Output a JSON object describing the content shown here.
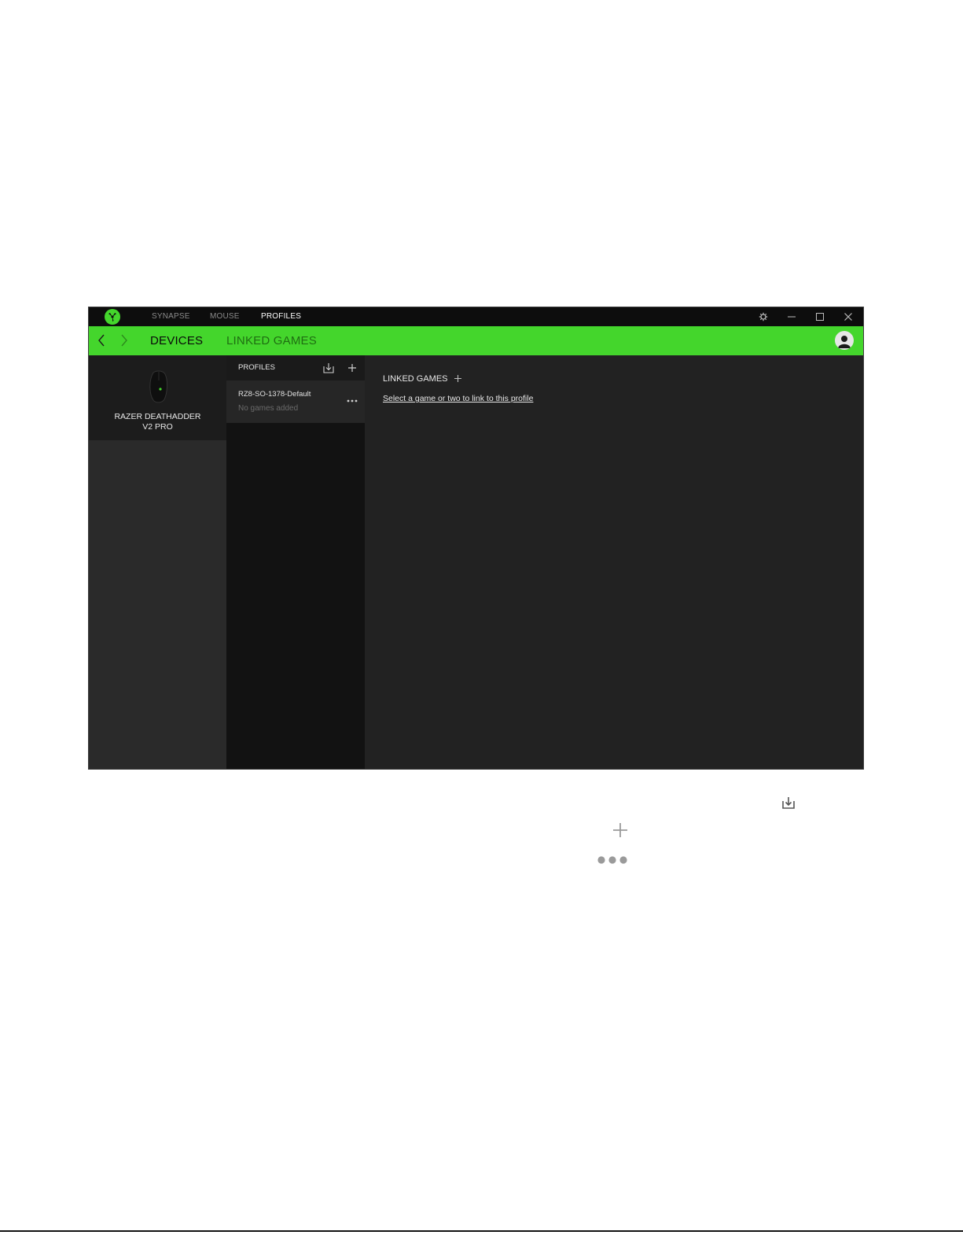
{
  "titlebar": {
    "tabs": [
      {
        "label": "SYNAPSE",
        "active": false
      },
      {
        "label": "MOUSE",
        "active": false
      },
      {
        "label": "PROFILES",
        "active": true
      }
    ],
    "controls": [
      "gear-icon",
      "minimize-icon",
      "maximize-icon",
      "close-icon"
    ]
  },
  "subnav": {
    "tabs": [
      {
        "label": "DEVICES",
        "active": true
      },
      {
        "label": "LINKED GAMES",
        "active": false
      }
    ]
  },
  "device": {
    "name_line1": "RAZER DEATHADDER",
    "name_line2": "V2 PRO"
  },
  "profiles": {
    "title": "PROFILES",
    "items": [
      {
        "name": "RZ8-SO-1378-Default",
        "subtitle": "No games added"
      }
    ]
  },
  "linked_games": {
    "title": "LINKED GAMES",
    "link_text": "Select a game or two to link to this profile"
  },
  "legend": {
    "icons": [
      "import-icon",
      "add-icon",
      "more-icon"
    ]
  },
  "colors": {
    "accent": "#44d62c",
    "titlebar": "#0d0d0d",
    "panel": "#222222"
  }
}
